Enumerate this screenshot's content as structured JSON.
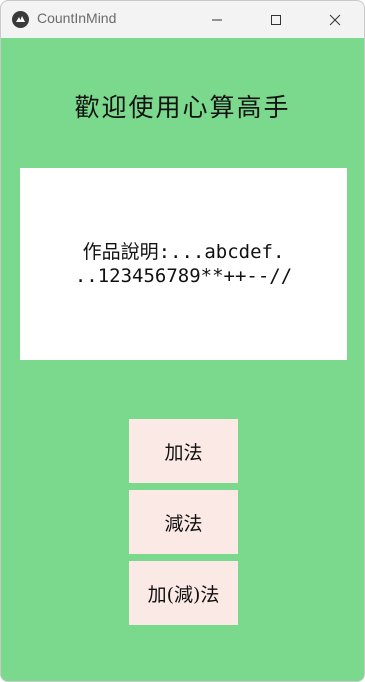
{
  "window": {
    "title": "CountInMind"
  },
  "main": {
    "heading": "歡迎使用心算高手",
    "description_line1": "作品說明:...abcdef.",
    "description_line2": "..123456789**++--//"
  },
  "buttons": {
    "addition": "加法",
    "subtraction": "減法",
    "mixed": "加(減)法"
  },
  "colors": {
    "background": "#7bd98d",
    "button_bg": "#fbe9e6",
    "panel_bg": "#ffffff"
  },
  "icons": {
    "app": "kivy-app-icon",
    "minimize": "minimize-icon",
    "maximize": "maximize-icon",
    "close": "close-icon"
  }
}
